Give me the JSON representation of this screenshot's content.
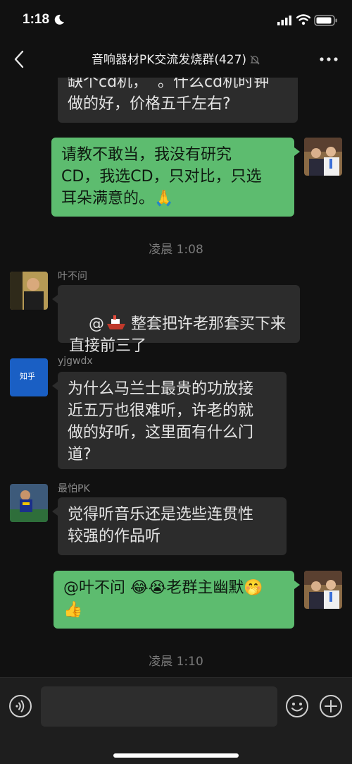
{
  "status_bar": {
    "time": "1:18"
  },
  "header": {
    "title": "音响器材PK交流发烧群(427)"
  },
  "messages": [
    {
      "sender": "",
      "text": "缺个cd机，  。什么cd机时钟\n做的好，价格五千左右?"
    },
    {
      "sender": "",
      "text": "请教不敢当，我没有研究\nCD，我选CD，只对比，只选\n耳朵满意的。🙏"
    },
    {
      "timestamp": "凌晨 1:08"
    },
    {
      "sender": "叶不问",
      "text": "整套把许老那套买下来\n直接前三了",
      "mention": "@"
    },
    {
      "sender": "yjgwdx",
      "text": "为什么马兰士最贵的功放接\n近五万也很难听，许老的就\n做的好听，这里面有什么门\n道?",
      "avatar_label": "知乎"
    },
    {
      "sender": "最怕PK",
      "text": "觉得听音乐还是选些连贯性\n较强的作品听"
    },
    {
      "sender": "",
      "text": "@叶不问 😂😭老群主幽默🤭\n👍"
    },
    {
      "timestamp": "凌晨 1:10"
    }
  ],
  "input_bar": {
    "placeholder": ""
  },
  "colors": {
    "mine_bubble": "#5dbc6f",
    "other_bubble": "#2c2c2c",
    "background": "#111111"
  },
  "icons": [
    "moon-icon",
    "signal-icon",
    "wifi-icon",
    "battery-icon",
    "back-arrow-icon",
    "mute-bell-icon",
    "more-dots-icon",
    "voice-icon",
    "emoji-icon",
    "add-icon"
  ]
}
